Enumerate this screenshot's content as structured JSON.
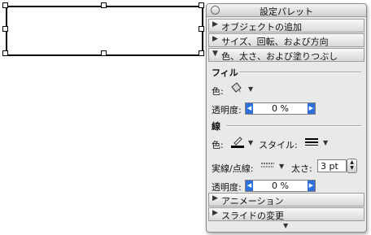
{
  "palette": {
    "title": "設定パレット",
    "sections": {
      "objects": "オブジェクトの追加",
      "size": "サイズ、回転、および方向",
      "color_line": "色、太さ、および塗りつぶし",
      "animation": "アニメーション",
      "slide": "スライドの変更"
    },
    "fill": {
      "header": "フィル",
      "color_label": "色:",
      "transparency_label": "透明度:",
      "transparency_value": "0 %"
    },
    "line": {
      "header": "線",
      "color_label": "色:",
      "style_label": "スタイル:",
      "dash_label": "実線/点線:",
      "weight_label": "太さ:",
      "weight_value": "3 pt",
      "transparency_label": "透明度:",
      "transparency_value": "0 %"
    },
    "icons": {
      "close": "close-icon",
      "collapsed": "triangle-right-icon",
      "expanded": "triangle-down-icon",
      "fill_bucket": "paint-bucket-icon",
      "pen": "pen-icon",
      "line_style": "line-style-icon",
      "dash_style": "dash-style-icon",
      "more": "triangle-down-icon"
    },
    "colors": {
      "accent": "#2f6fd9",
      "line_color": "#000000"
    }
  }
}
